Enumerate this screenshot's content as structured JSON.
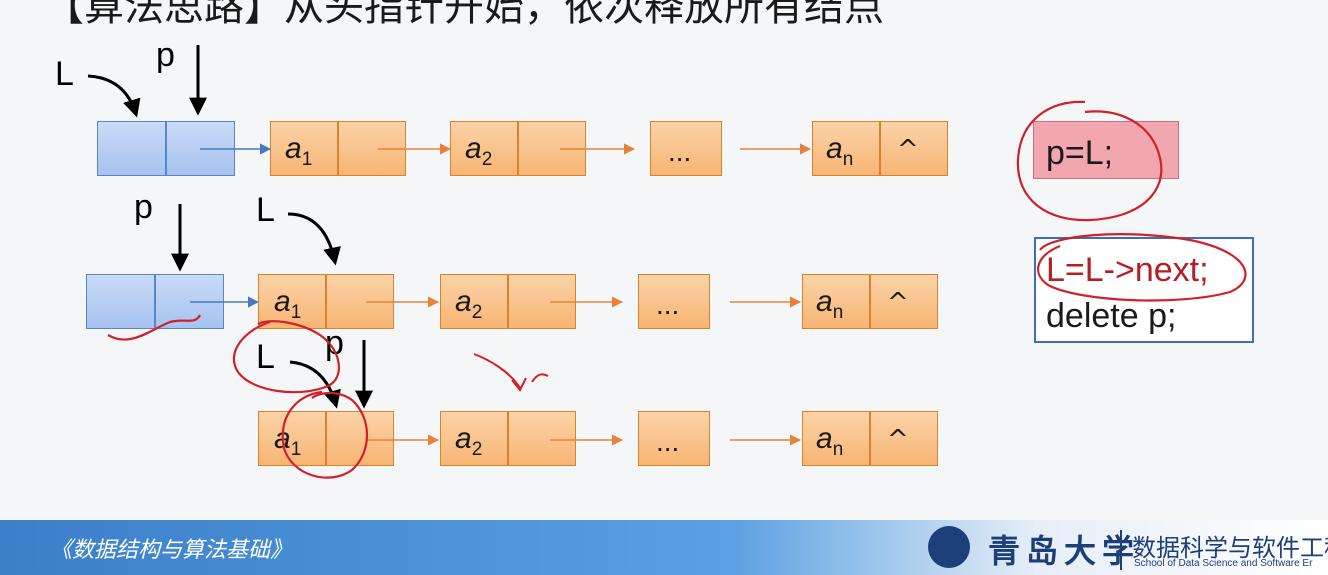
{
  "title": "【算法思路】从头指针开始，依次释放所有结点",
  "labels": {
    "L": "L",
    "p": "p"
  },
  "node_text": {
    "a": "a",
    "sub1": "1",
    "sub2": "2",
    "subn": "n",
    "ellipsis": "...",
    "null": "^"
  },
  "code": {
    "step1": "p=L;",
    "step2_line1": "L=L->next;",
    "step2_line2": "delete p;"
  },
  "footer": {
    "course": "《数据结构与算法基础》",
    "university": "青岛大学",
    "school": "数据科学与软件工程",
    "school_en": "School of Data Science and Software Er"
  },
  "colors": {
    "node_fill": "#f7b574",
    "head_fill": "#a6c3ef",
    "annotation": "#d0202a",
    "footer_blue": "#3a7fc8"
  }
}
